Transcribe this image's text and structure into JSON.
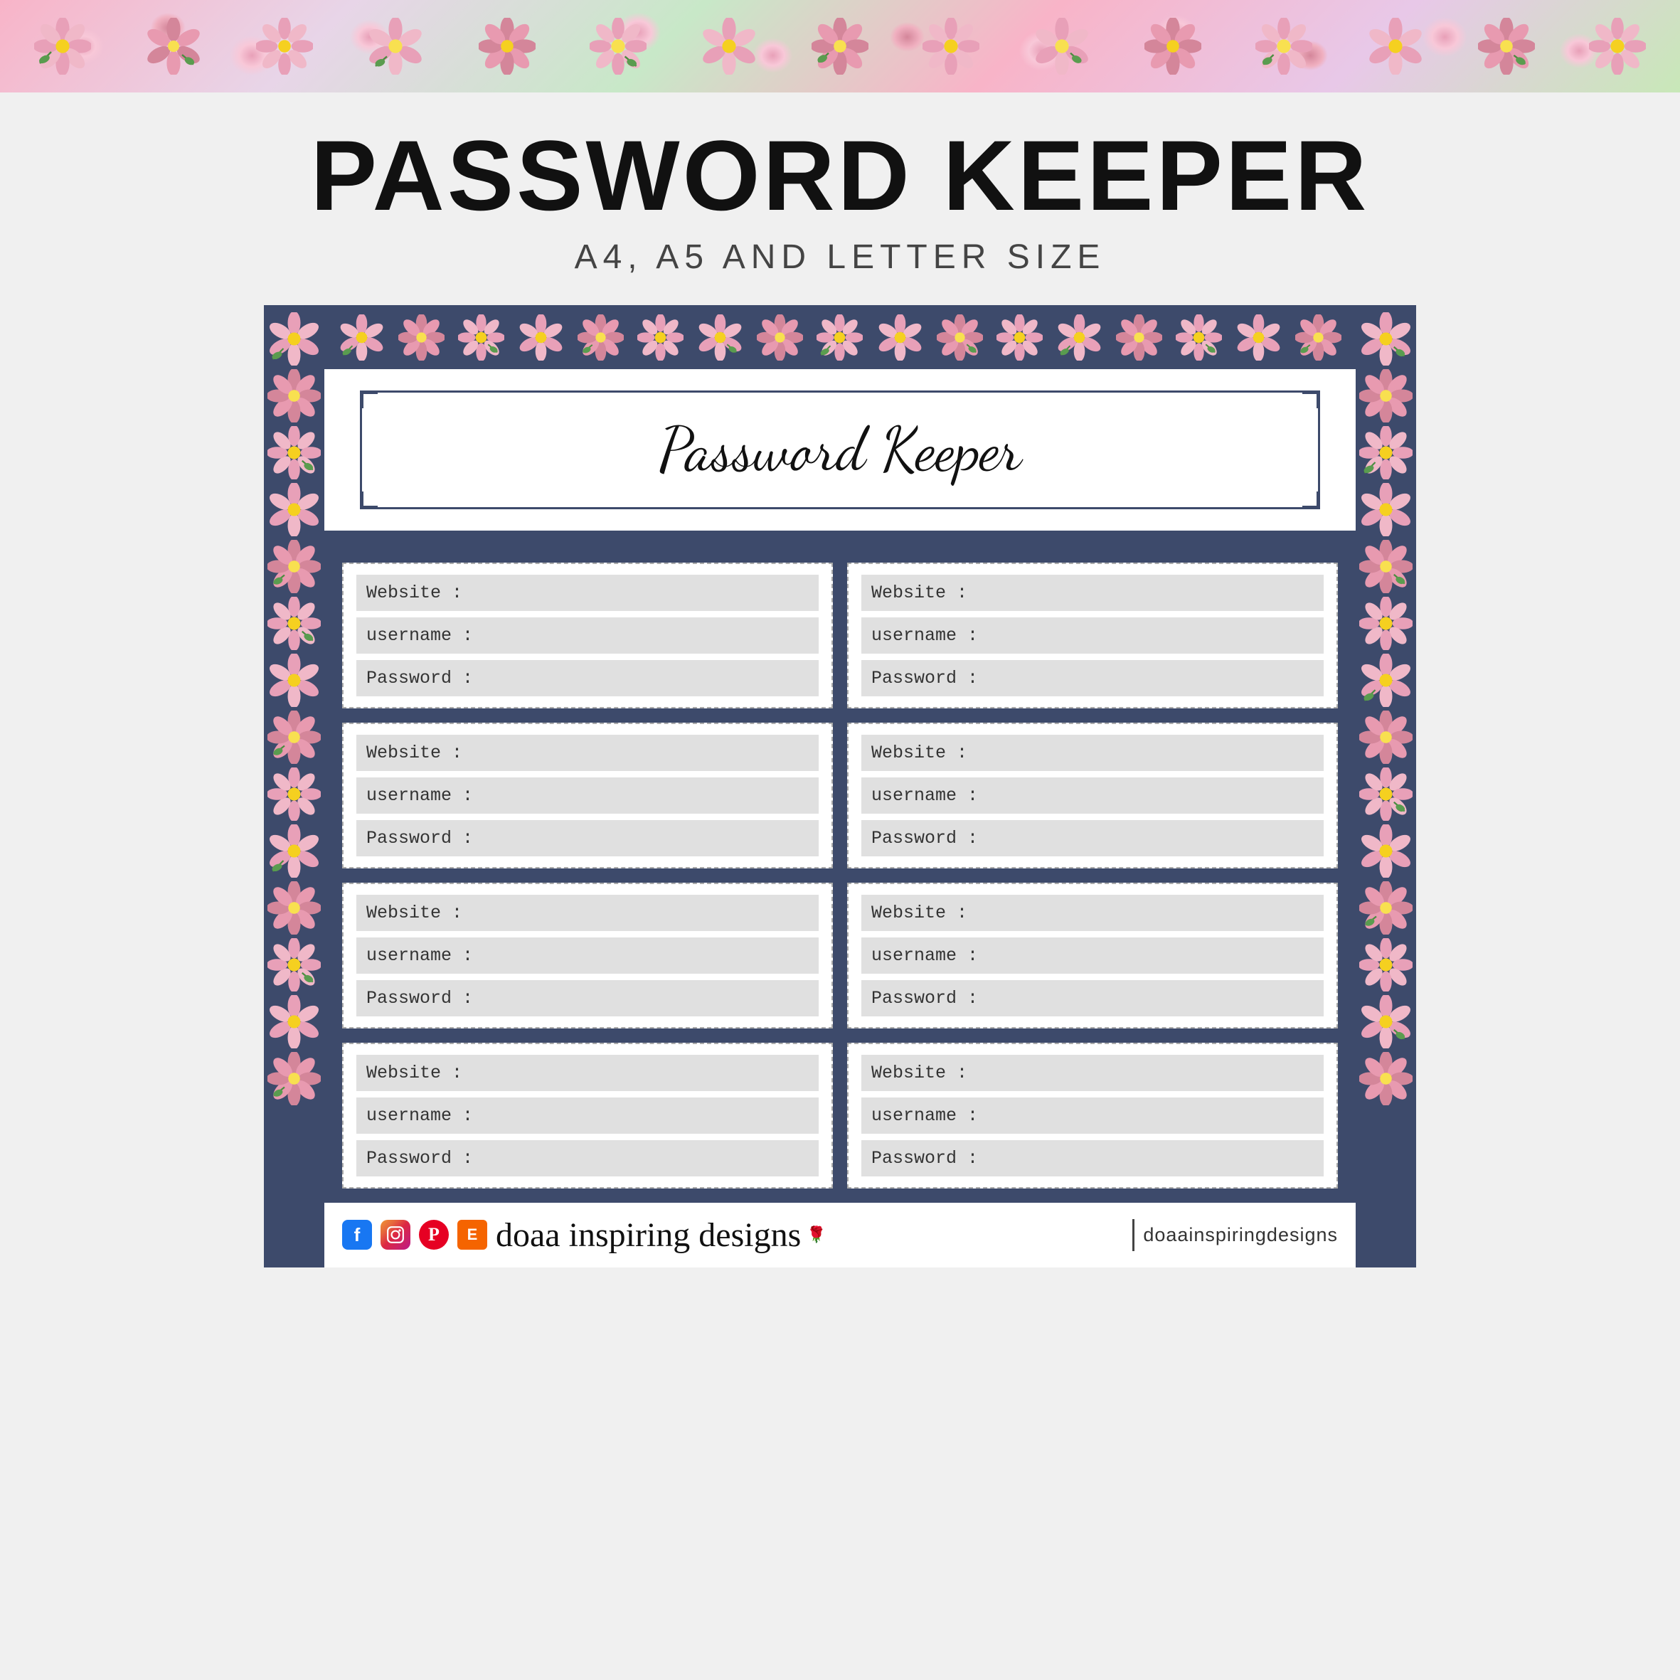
{
  "header": {
    "title": "PASSWORD KEEPER",
    "subtitle": "A4, A5 AND LETTER SIZE"
  },
  "document": {
    "title": "Password Keeper",
    "entries_per_row": 2,
    "total_rows": 4,
    "fields": [
      "Website :",
      "username :",
      "Password :"
    ]
  },
  "brand": {
    "name": "doaa inspiring designs",
    "handle": "doaainspiringdesigns",
    "rose_icon": "🌹"
  },
  "colors": {
    "navy": "#3d4a6b",
    "light_gray": "#e0e0e0",
    "pink_floral": "#f8b4c8",
    "background": "#f0f0f0"
  }
}
